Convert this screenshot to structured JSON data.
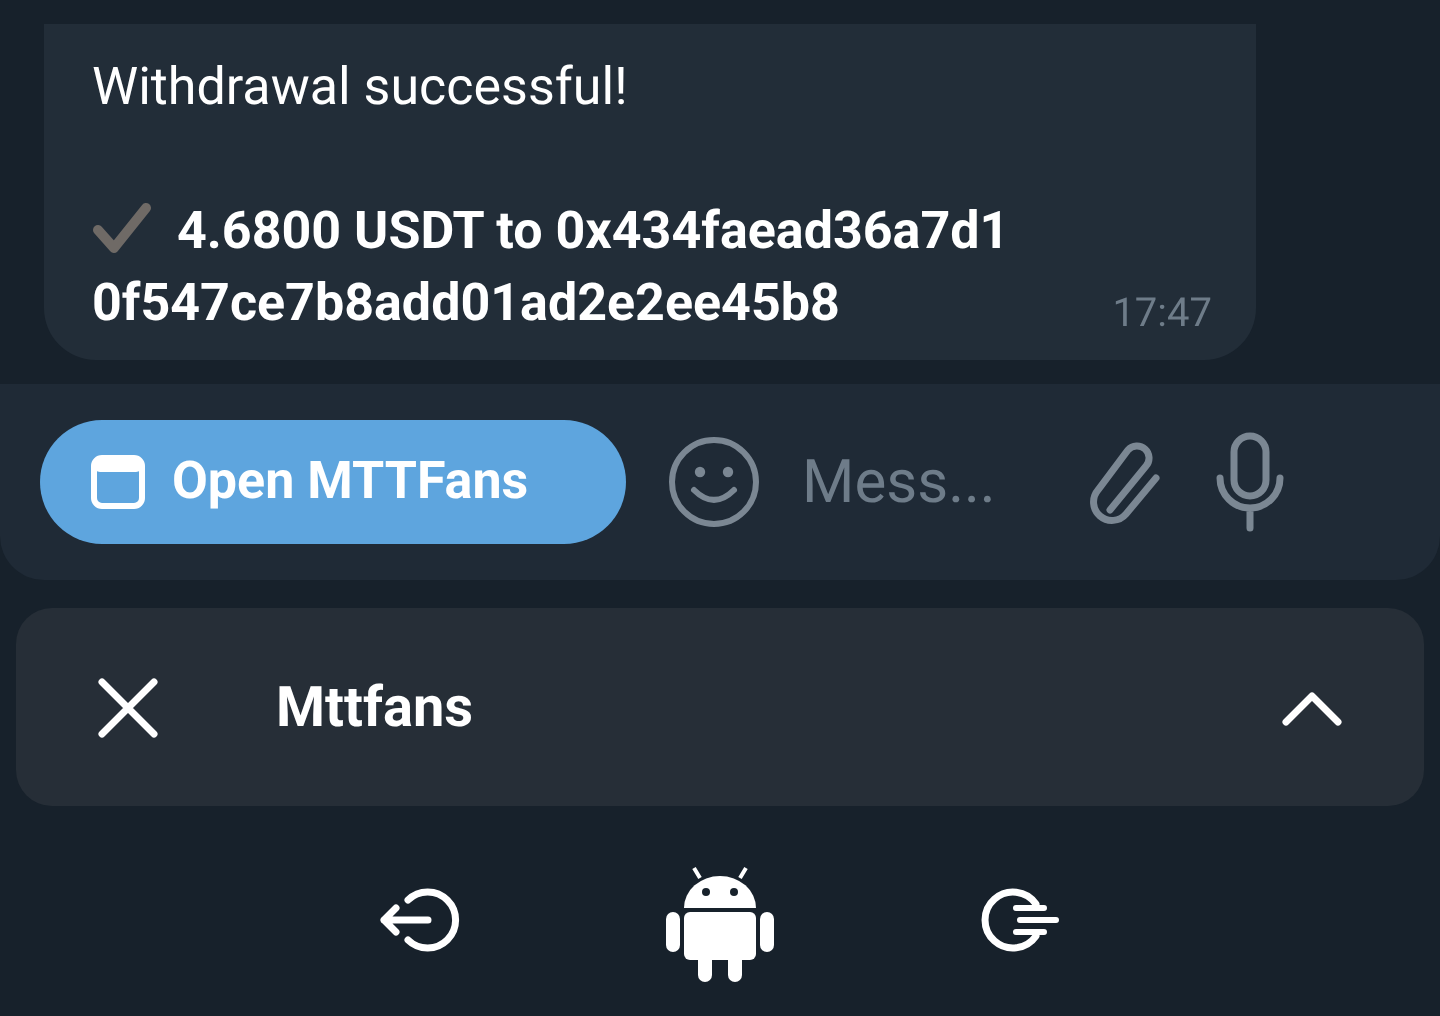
{
  "message": {
    "title": "Withdrawal successful!",
    "body_lines": [
      "4.6800 USDT to 0x434faead36a7d1",
      "0f547ce7b8add01ad2e2ee45b8"
    ],
    "time": "17:47"
  },
  "composer": {
    "app_button": "Open MTTFans",
    "placeholder": "Mess..."
  },
  "mini_app_bar": {
    "title": "Mttfans"
  }
}
